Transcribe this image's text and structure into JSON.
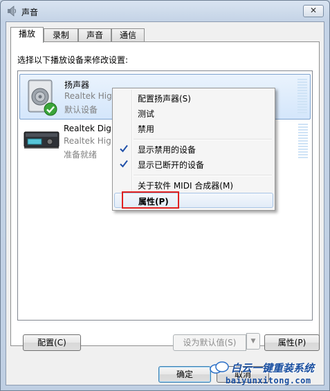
{
  "window": {
    "title": "声音",
    "close_symbol": "✕",
    "title_icon": "speaker-icon"
  },
  "tabs": [
    {
      "label": "播放",
      "active": true
    },
    {
      "label": "录制",
      "active": false
    },
    {
      "label": "声音",
      "active": false
    },
    {
      "label": "通信",
      "active": false
    }
  ],
  "instruction": "选择以下播放设备来修改设置:",
  "devices": [
    {
      "name": "扬声器",
      "sub": "Realtek Hig",
      "status": "默认设备",
      "icon": "speaker-device-icon",
      "badge": "default-check-icon",
      "selected": true
    },
    {
      "name": "Realtek Dig",
      "sub": "Realtek Hig",
      "status": "准备就绪",
      "icon": "digital-output-device-icon",
      "selected": false
    }
  ],
  "context_menu": {
    "items": [
      {
        "label": "配置扬声器(S)",
        "checked": false
      },
      {
        "label": "测试",
        "checked": false
      },
      {
        "label": "禁用",
        "checked": false
      },
      {
        "label": "显示禁用的设备",
        "checked": true
      },
      {
        "label": "显示已断开的设备",
        "checked": true
      },
      {
        "label": "关于软件 MIDI 合成器(M)",
        "checked": false
      },
      {
        "label": "属性(P)",
        "checked": false,
        "hover": true
      }
    ]
  },
  "buttons": {
    "configure": "配置(C)",
    "set_default": "设为默认值(S)",
    "properties": "属性(P)",
    "ok": "确定",
    "cancel": "取消"
  },
  "watermark": {
    "title": "白云一键重装系统",
    "url": "baiyunxitong.com"
  },
  "colors": {
    "highlight": "#e02020",
    "check": "#1f4fa8",
    "selection": "#d4e6fb"
  }
}
